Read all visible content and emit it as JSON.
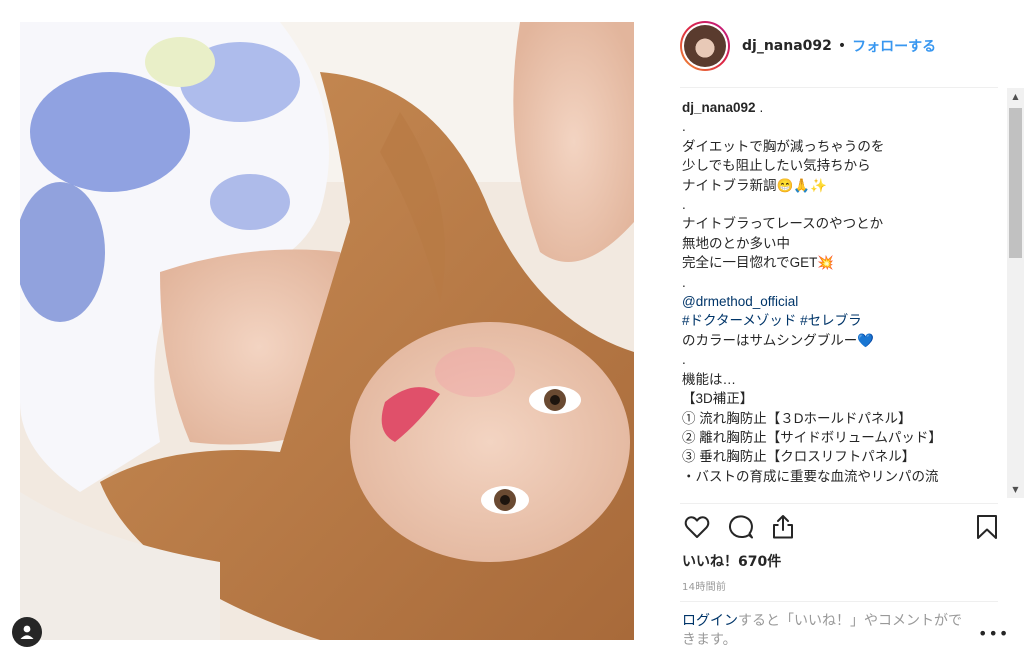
{
  "post": {
    "username": "dj_nana092",
    "header_dot": "•",
    "follow_label": "フォローする"
  },
  "caption": {
    "username": "dj_nana092",
    "first_line_rest": ".",
    "lines": [
      ".",
      "ダイエットで胸が減っちゃうのを",
      "少しでも阻止したい気持ちから",
      "ナイトブラ新調😁🙏✨",
      ".",
      "ナイトブラってレースのやつとか",
      "無地のとか多い中",
      "完全に一目惚れでGET💥",
      ".",
      "@drmethod_official",
      "#ドクターメゾッド #セレブラ",
      "のカラーはサムシングブルー💙",
      ".",
      "機能は…",
      "【3D補正】",
      "① 流れ胸防止【３Dホールドパネル】",
      "② 離れ胸防止【サイドボリュームパッド】",
      "③ 垂れ胸防止【クロスリフトパネル】",
      "・バストの育成に重要な血流やリンパの流"
    ]
  },
  "actions": {
    "like_icon": "heart-icon",
    "comment_icon": "comment-icon",
    "share_icon": "share-icon",
    "save_icon": "bookmark-icon"
  },
  "likes_text": "いいね！670件",
  "timestamp": "14時間前",
  "login_prompt": {
    "link": "ログイン",
    "rest": "すると「いいね！」やコメントができます。"
  },
  "more_label": "•••",
  "colors": {
    "link_blue": "#3897f0",
    "text": "#262626",
    "muted": "#999999",
    "mention": "#003569"
  }
}
